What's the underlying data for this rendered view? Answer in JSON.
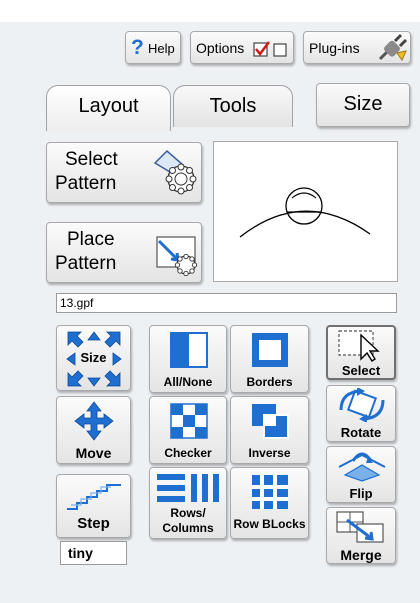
{
  "toolbar": {
    "help_label": "Help",
    "help_glyph": "?",
    "options_label": "Options",
    "plugins_label": "Plug-ins"
  },
  "tabs": {
    "layout": "Layout",
    "tools": "Tools",
    "size": "Size"
  },
  "pattern_buttons": {
    "select_line1": "Select",
    "select_line2": "Pattern",
    "place_line1": "Place",
    "place_line2": "Pattern"
  },
  "file_field": {
    "value": "13.gpf"
  },
  "tools": {
    "size": "Size",
    "move": "Move",
    "step": "Step",
    "step_value": "tiny",
    "all_none": "All/None",
    "borders": "Borders",
    "checker": "Checker",
    "inverse": "Inverse",
    "rows_columns_line1": "Rows/",
    "rows_columns_line2": "Columns",
    "row_blocks": "Row BLocks",
    "select": "Select",
    "rotate": "Rotate",
    "flip": "Flip",
    "merge": "Merge"
  },
  "colors": {
    "accent_blue": "#1f6fd0",
    "check_red": "#d01818"
  }
}
